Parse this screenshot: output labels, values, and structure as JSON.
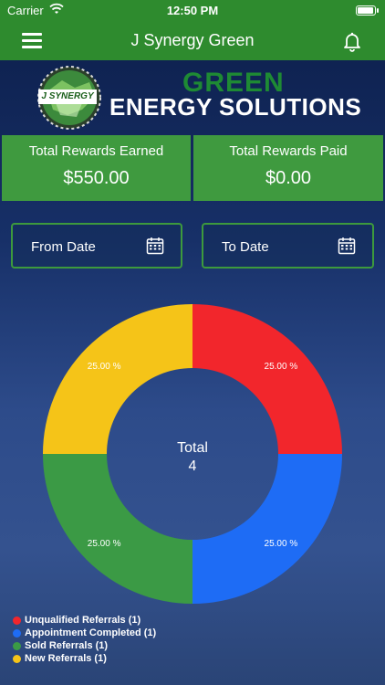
{
  "status_bar": {
    "carrier": "Carrier",
    "time": "12:50 PM"
  },
  "nav": {
    "title": "J Synergy Green"
  },
  "banner": {
    "logo_text": "J SYNERGY",
    "headline": "GREEN",
    "subheadline": "ENERGY SOLUTIONS"
  },
  "rewards": {
    "earned_label": "Total Rewards Earned",
    "earned_value": "$550.00",
    "paid_label": "Total Rewards Paid",
    "paid_value": "$0.00"
  },
  "filters": {
    "from_label": "From Date",
    "to_label": "To Date"
  },
  "colors": {
    "brand_green": "#2e8b2e",
    "red": "#f2262c",
    "blue": "#1e6cf5",
    "green": "#3b9a45",
    "yellow": "#f5c418"
  },
  "chart_data": {
    "type": "pie",
    "donut": true,
    "center_title": "Total",
    "center_value": "4",
    "slices": [
      {
        "name": "Unqualified Referrals",
        "count": 1,
        "percent_label": "25.00 %",
        "color": "#f2262c"
      },
      {
        "name": "Appointment Completed",
        "count": 1,
        "percent_label": "25.00 %",
        "color": "#1e6cf5"
      },
      {
        "name": "Sold Referrals",
        "count": 1,
        "percent_label": "25.00 %",
        "color": "#3b9a45"
      },
      {
        "name": "New Referrals",
        "count": 1,
        "percent_label": "25.00 %",
        "color": "#f5c418"
      }
    ],
    "legend": [
      "Unqualified Referrals (1)",
      "Appointment Completed (1)",
      "Sold Referrals (1)",
      "New Referrals (1)"
    ],
    "legend_position": "bottom-left"
  }
}
